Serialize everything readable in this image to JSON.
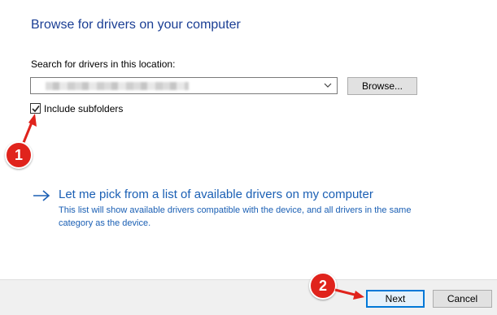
{
  "dialog": {
    "heading": "Browse for drivers on your computer"
  },
  "search": {
    "label": "Search for drivers in this location:",
    "path_value": "",
    "browse_label": "Browse..."
  },
  "subfolders": {
    "label": "Include subfolders",
    "checked": true
  },
  "pick_option": {
    "title": "Let me pick from a list of available drivers on my computer",
    "description": "This list will show available drivers compatible with the device, and all drivers in the same category as the device."
  },
  "footer": {
    "next_label": "Next",
    "cancel_label": "Cancel"
  },
  "annotations": {
    "step1_number": "1",
    "step2_number": "2",
    "marker_color": "#e0231c"
  },
  "colors": {
    "heading": "#1a3e94",
    "link": "#1a5fb4",
    "focus_border": "#0078d7"
  },
  "icons": {
    "combo_dropdown": "chevron-down-icon",
    "checkbox_mark": "checkmark-icon",
    "link_arrow": "arrow-right-icon",
    "annotation_arrow": "red-arrow-icon"
  }
}
